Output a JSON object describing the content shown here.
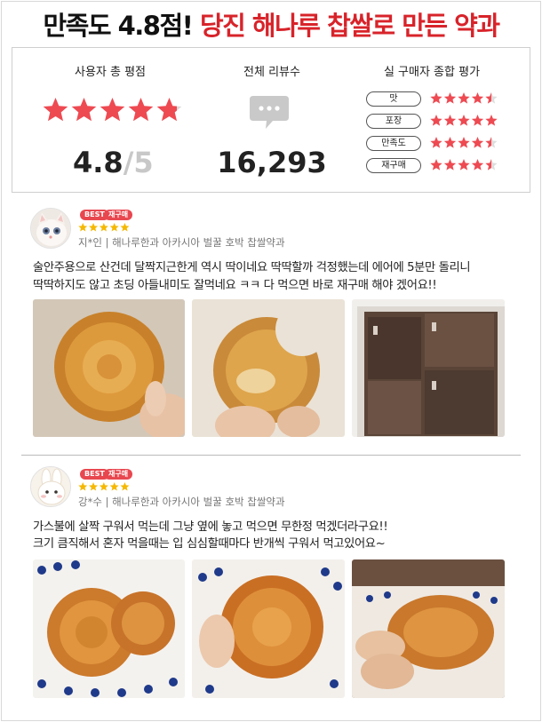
{
  "headline": {
    "part1": "만족도 4.8점!",
    "part2": " 당진 해나루 찹쌀로 만든 약과"
  },
  "summary": {
    "avg_title": "사용자 총 평점",
    "avg_score": "4.8",
    "avg_max": "/5",
    "avg_stars_value": 4.8,
    "count_title": "전체 리뷰수",
    "count_value": "16,293",
    "breakdown_title": "실 구매자 종합 평가",
    "breakdown": [
      {
        "label": "맛",
        "stars": 4.5
      },
      {
        "label": "포장",
        "stars": 5
      },
      {
        "label": "만족도",
        "stars": 4.5
      },
      {
        "label": "재구매",
        "stars": 4.5
      }
    ]
  },
  "reviews": [
    {
      "badges": [
        "BEST",
        "재구매"
      ],
      "stars": 5,
      "reviewer": "지*인 | 해나루한과 아카시아 벌꿀 호박 찹쌀약과",
      "lines": [
        "술안주용으로 산건데 달짝지근한게 역시 딱이네요 딱딱할까 걱정했는데 에어에 5분만 돌리니",
        "딱딱하지도 않고 초딩 아들내미도 잘먹네요 ㅋㅋ 다 먹으면 바로 재구매 해야 겠어요!!"
      ]
    },
    {
      "badges": [
        "BEST",
        "재구매"
      ],
      "stars": 5,
      "reviewer": "강*수 | 해나루한과 아카시아 벌꿀 호박 찹쌀약과",
      "lines": [
        "가스불에 살짝 구워서 먹는데 그냥 옆에 놓고 먹으면 무한정 먹겠더라구요!!",
        "크기 큼직해서 혼자 먹을때는 입 심심할때마다 반개씩 구워서 먹고있어요~"
      ]
    }
  ],
  "colors": {
    "accent_red": "#d8232a",
    "star_red": "#ee4a52",
    "badge_red": "#e8474f",
    "gold_star": "#f5b800"
  },
  "icons": {
    "bubble": "speech-bubble-icon",
    "star": "star-icon"
  }
}
